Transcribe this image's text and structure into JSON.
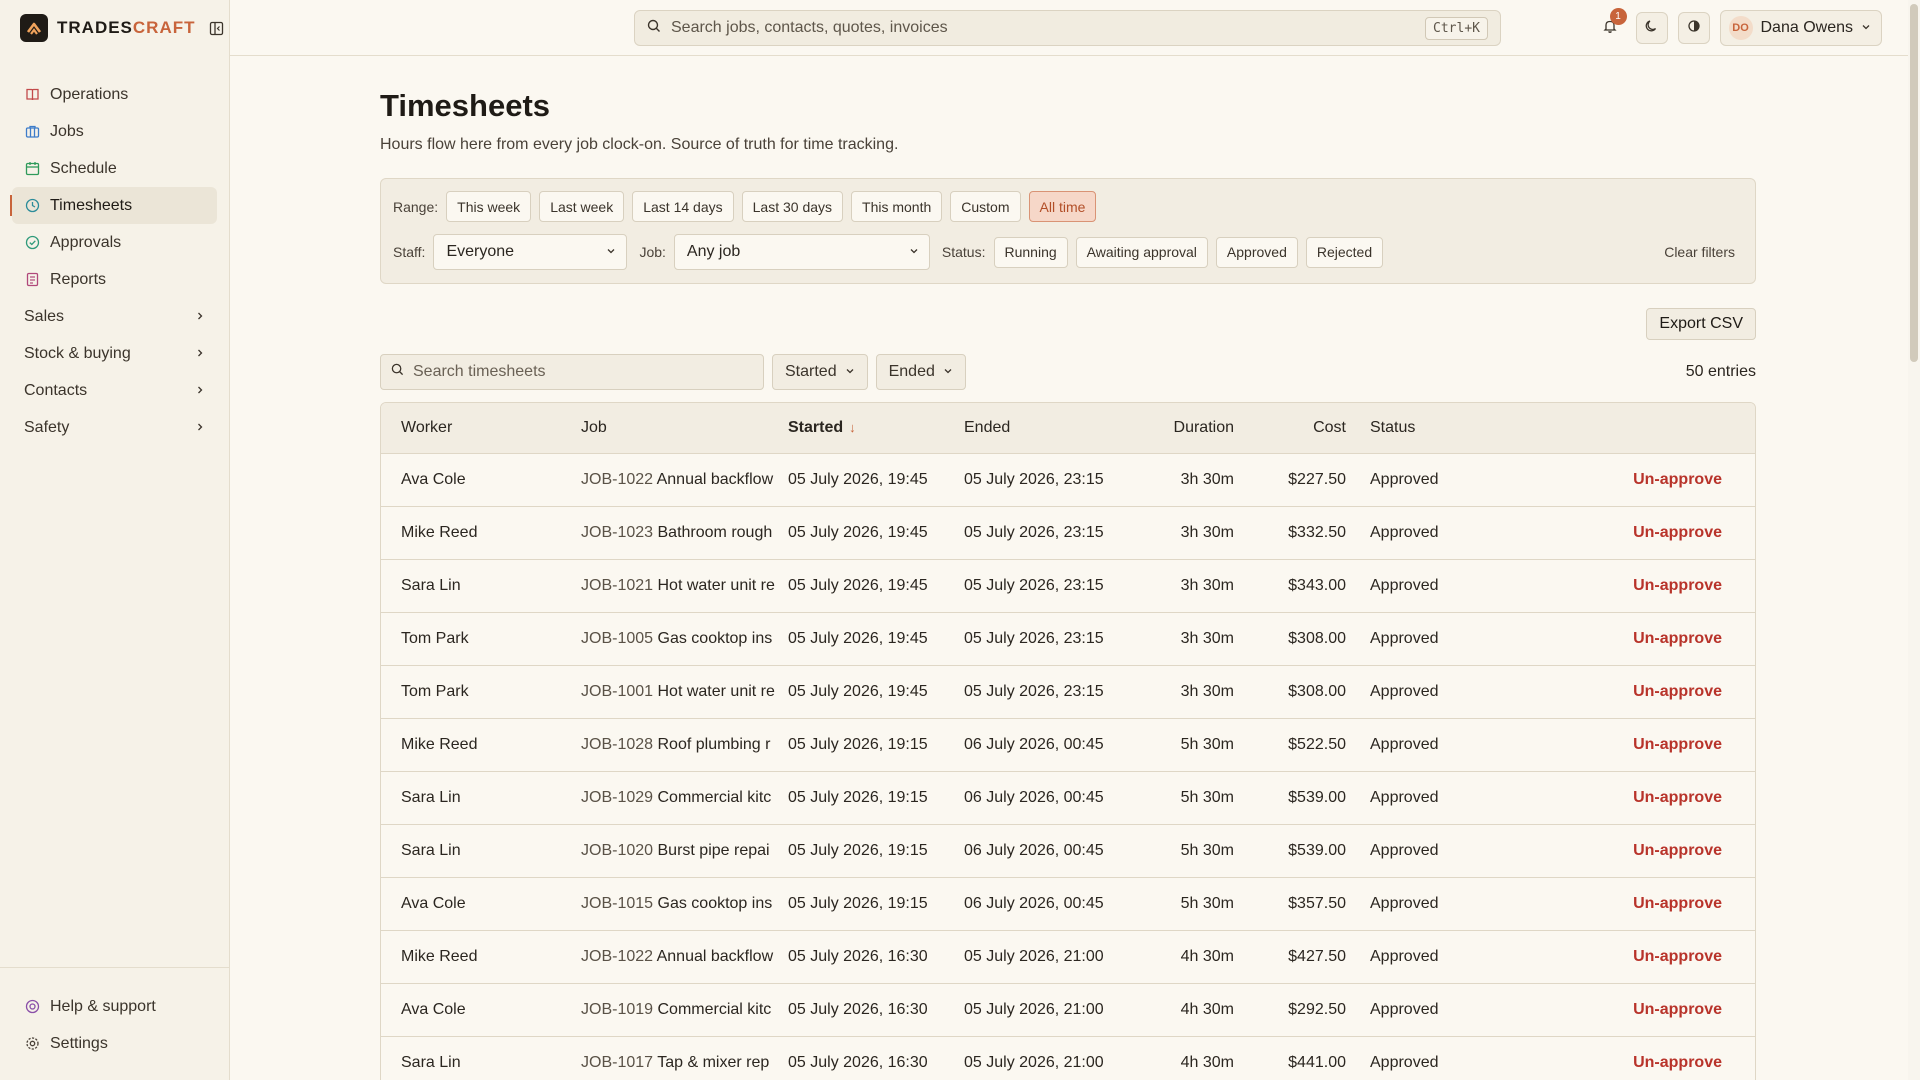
{
  "app": {
    "brand_left": "TRADES",
    "brand_right": "CRAFT"
  },
  "sidebar": {
    "items": [
      {
        "label": "Operations",
        "icon": "book-icon"
      },
      {
        "label": "Jobs",
        "icon": "briefcase-icon"
      },
      {
        "label": "Schedule",
        "icon": "calendar-icon"
      },
      {
        "label": "Timesheets",
        "icon": "clock-icon"
      },
      {
        "label": "Approvals",
        "icon": "check-circle-icon"
      },
      {
        "label": "Reports",
        "icon": "report-icon"
      }
    ],
    "groups": [
      "Sales",
      "Stock & buying",
      "Contacts",
      "Safety"
    ],
    "bottom": [
      {
        "label": "Help & support"
      },
      {
        "label": "Settings"
      }
    ]
  },
  "topbar": {
    "search_placeholder": "Search jobs, contacts, quotes, invoices",
    "shortcut": "Ctrl+K",
    "notif_count": "1",
    "user_initials": "DO",
    "user_name": "Dana Owens"
  },
  "page": {
    "title": "Timesheets",
    "subtitle": "Hours flow here from every job clock-on. Source of truth for time tracking."
  },
  "filters": {
    "range_label": "Range:",
    "ranges": [
      "This week",
      "Last week",
      "Last 14 days",
      "Last 30 days",
      "This month",
      "Custom",
      "All time"
    ],
    "active_range": "All time",
    "staff_label": "Staff:",
    "staff_value": "Everyone",
    "job_label": "Job:",
    "job_value": "Any job",
    "status_label": "Status:",
    "statuses": [
      "Running",
      "Awaiting approval",
      "Approved",
      "Rejected"
    ],
    "clear": "Clear filters"
  },
  "actions": {
    "export": "Export CSV"
  },
  "toolbar": {
    "search_placeholder": "Search timesheets",
    "started": "Started",
    "ended": "Ended",
    "entries": "50 entries"
  },
  "table": {
    "headers": {
      "worker": "Worker",
      "job": "Job",
      "started": "Started",
      "ended": "Ended",
      "duration": "Duration",
      "cost": "Cost",
      "status": "Status"
    },
    "rows": [
      {
        "worker": "Ava Cole",
        "job_id": "JOB-1022",
        "job_name": "Annual backflow",
        "started": "05 July 2026, 19:45",
        "ended": "05 July 2026, 23:15",
        "duration": "3h 30m",
        "cost": "$227.50",
        "status": "Approved",
        "action": "Un-approve"
      },
      {
        "worker": "Mike Reed",
        "job_id": "JOB-1023",
        "job_name": "Bathroom rough",
        "started": "05 July 2026, 19:45",
        "ended": "05 July 2026, 23:15",
        "duration": "3h 30m",
        "cost": "$332.50",
        "status": "Approved",
        "action": "Un-approve"
      },
      {
        "worker": "Sara Lin",
        "job_id": "JOB-1021",
        "job_name": "Hot water unit re",
        "started": "05 July 2026, 19:45",
        "ended": "05 July 2026, 23:15",
        "duration": "3h 30m",
        "cost": "$343.00",
        "status": "Approved",
        "action": "Un-approve"
      },
      {
        "worker": "Tom Park",
        "job_id": "JOB-1005",
        "job_name": "Gas cooktop ins",
        "started": "05 July 2026, 19:45",
        "ended": "05 July 2026, 23:15",
        "duration": "3h 30m",
        "cost": "$308.00",
        "status": "Approved",
        "action": "Un-approve"
      },
      {
        "worker": "Tom Park",
        "job_id": "JOB-1001",
        "job_name": "Hot water unit re",
        "started": "05 July 2026, 19:45",
        "ended": "05 July 2026, 23:15",
        "duration": "3h 30m",
        "cost": "$308.00",
        "status": "Approved",
        "action": "Un-approve"
      },
      {
        "worker": "Mike Reed",
        "job_id": "JOB-1028",
        "job_name": "Roof plumbing r",
        "started": "05 July 2026, 19:15",
        "ended": "06 July 2026, 00:45",
        "duration": "5h 30m",
        "cost": "$522.50",
        "status": "Approved",
        "action": "Un-approve"
      },
      {
        "worker": "Sara Lin",
        "job_id": "JOB-1029",
        "job_name": "Commercial kitc",
        "started": "05 July 2026, 19:15",
        "ended": "06 July 2026, 00:45",
        "duration": "5h 30m",
        "cost": "$539.00",
        "status": "Approved",
        "action": "Un-approve"
      },
      {
        "worker": "Sara Lin",
        "job_id": "JOB-1020",
        "job_name": "Burst pipe repai",
        "started": "05 July 2026, 19:15",
        "ended": "06 July 2026, 00:45",
        "duration": "5h 30m",
        "cost": "$539.00",
        "status": "Approved",
        "action": "Un-approve"
      },
      {
        "worker": "Ava Cole",
        "job_id": "JOB-1015",
        "job_name": "Gas cooktop ins",
        "started": "05 July 2026, 19:15",
        "ended": "06 July 2026, 00:45",
        "duration": "5h 30m",
        "cost": "$357.50",
        "status": "Approved",
        "action": "Un-approve"
      },
      {
        "worker": "Mike Reed",
        "job_id": "JOB-1022",
        "job_name": "Annual backflow",
        "started": "05 July 2026, 16:30",
        "ended": "05 July 2026, 21:00",
        "duration": "4h 30m",
        "cost": "$427.50",
        "status": "Approved",
        "action": "Un-approve"
      },
      {
        "worker": "Ava Cole",
        "job_id": "JOB-1019",
        "job_name": "Commercial kitc",
        "started": "05 July 2026, 16:30",
        "ended": "05 July 2026, 21:00",
        "duration": "4h 30m",
        "cost": "$292.50",
        "status": "Approved",
        "action": "Un-approve"
      },
      {
        "worker": "Sara Lin",
        "job_id": "JOB-1017",
        "job_name": "Tap & mixer rep",
        "started": "05 July 2026, 16:30",
        "ended": "05 July 2026, 21:00",
        "duration": "4h 30m",
        "cost": "$441.00",
        "status": "Approved",
        "action": "Un-approve"
      }
    ]
  },
  "colors": {
    "accent": "#c8643b",
    "danger": "#b8332a",
    "background": "#fbf8f1",
    "sidebar": "#f6f2e8"
  }
}
